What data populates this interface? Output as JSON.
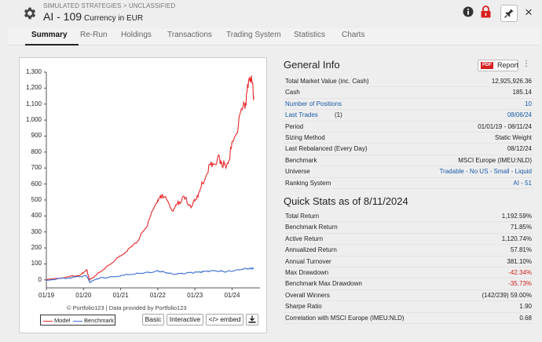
{
  "header": {
    "breadcrumb": "SIMULATED STRATEGIES > UNCLASSIFIED",
    "title": "AI - 109",
    "subtitle": "Currency in EUR",
    "close_symbol": "×"
  },
  "tabs": [
    {
      "label": "Summary",
      "active": true
    },
    {
      "label": "Re-Run"
    },
    {
      "label": "Holdings"
    },
    {
      "label": "Transactions"
    },
    {
      "label": "Trading System"
    },
    {
      "label": "Statistics"
    },
    {
      "label": "Charts"
    }
  ],
  "chart": {
    "credit": "© Portfolio123 | Data provided by Portfolio123",
    "legend": [
      {
        "name": "Model",
        "color": "#e8262a"
      },
      {
        "name": "Benchmark",
        "color": "#3a6fd0"
      }
    ],
    "buttons": {
      "basic": "Basic",
      "interactive": "Interactive",
      "embed": "</> embed"
    }
  },
  "chart_data": {
    "type": "line",
    "y_ticks": [
      "1,300",
      "1,200",
      "1,100",
      "1,000",
      "900",
      "800",
      "700",
      "600",
      "500",
      "400",
      "300",
      "200",
      "100",
      "0"
    ],
    "x_ticks": [
      "01/19",
      "01/20",
      "01/21",
      "01/22",
      "01/23",
      "01/24"
    ],
    "ylim": [
      -50,
      1300
    ],
    "x": [
      "2019-01",
      "2019-07",
      "2019-12",
      "2020-02",
      "2020-03",
      "2020-06",
      "2020-09",
      "2021-01",
      "2021-06",
      "2021-09",
      "2022-01",
      "2022-03",
      "2022-06",
      "2022-09",
      "2022-12",
      "2023-03",
      "2023-06",
      "2023-09",
      "2023-11",
      "2024-02",
      "2024-05",
      "2024-07",
      "2024-08"
    ],
    "series": [
      {
        "name": "Model",
        "color": "#e8262a",
        "values": [
          0,
          15,
          30,
          65,
          0,
          45,
          90,
          150,
          230,
          320,
          500,
          520,
          430,
          520,
          460,
          580,
          720,
          760,
          700,
          900,
          1100,
          1260,
          1150
        ]
      },
      {
        "name": "Benchmark",
        "color": "#3a6fd0",
        "values": [
          0,
          10,
          20,
          25,
          -15,
          10,
          15,
          25,
          40,
          45,
          55,
          50,
          35,
          40,
          45,
          50,
          55,
          55,
          50,
          60,
          70,
          72,
          72
        ]
      }
    ]
  },
  "general_info": {
    "title": "General Info",
    "report_pdf": "PDF",
    "report_label": "Report",
    "rows": [
      {
        "label": "Total Market Value (inc. Cash)",
        "value": "12,925,926.36"
      },
      {
        "label": "Cash",
        "value": "185.14"
      },
      {
        "label": "Number of Positions",
        "value": "10",
        "link": true
      },
      {
        "label": "Last Trades",
        "label_suffix": " (1)",
        "value": "08/06/24",
        "link": true
      },
      {
        "label": "Period",
        "value": "01/01/19 - 08/11/24"
      },
      {
        "label": "Sizing Method",
        "value": "Static Weight"
      },
      {
        "label": "Last Rebalanced (Every Day)",
        "value": "08/12/24"
      },
      {
        "label": "Benchmark",
        "value": "MSCI Europe (IMEU:NLD)"
      },
      {
        "label": "Universe",
        "value": "Tradable - No US - Small - Liquid",
        "value_link": true
      },
      {
        "label": "Ranking System",
        "value": "AI - 51",
        "value_link": true
      }
    ]
  },
  "quick_stats": {
    "title": "Quick Stats as of 8/11/2024",
    "rows": [
      {
        "label": "Total Return",
        "value": "1,192.59%"
      },
      {
        "label": "Benchmark Return",
        "value": "71.85%"
      },
      {
        "label": "Active Return",
        "value": "1,120.74%"
      },
      {
        "label": "Annualized Return",
        "value": "57.81%"
      },
      {
        "label": "Annual Turnover",
        "value": "381.10%"
      },
      {
        "label": "Max Drawdown",
        "value": "-42.34%",
        "negative": true
      },
      {
        "label": "Benchmark Max Drawdown",
        "value": "-35.73%",
        "negative": true
      },
      {
        "label": "Overall Winners",
        "value": "(142/239) 59.00%"
      },
      {
        "label": "Sharpe Ratio",
        "value": "1.90"
      },
      {
        "label": "Correlation with MSCI Europe (IMEU:NLD)",
        "value": "0.68"
      }
    ]
  },
  "colors": {
    "accent_link": "#1a5aa8",
    "negative": "#d02020",
    "lock": "#d62020"
  }
}
